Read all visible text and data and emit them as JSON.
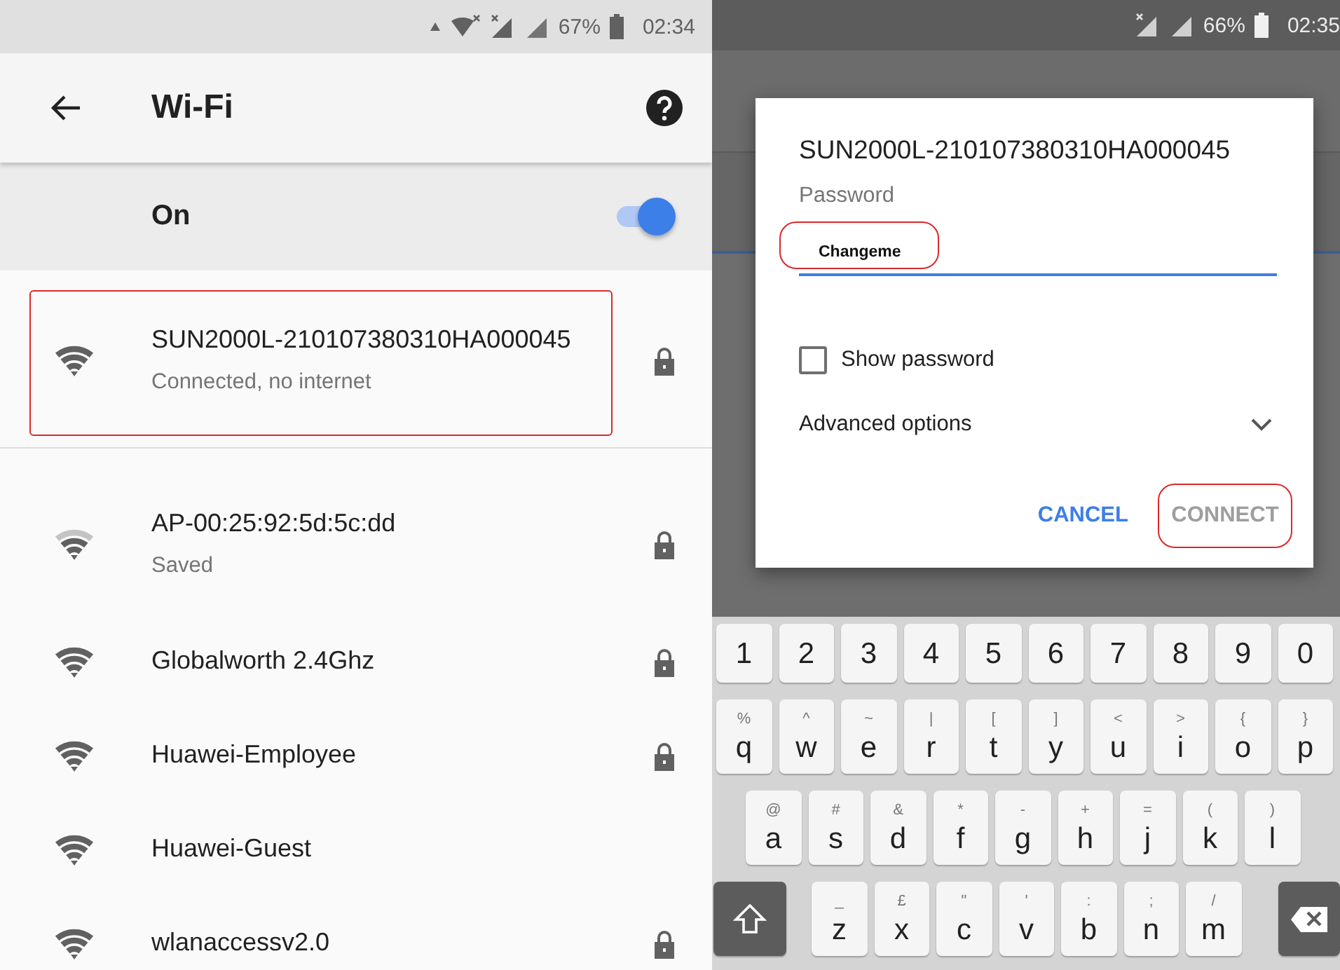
{
  "wifi_screen": {
    "status_bar": {
      "battery": "67%",
      "time": "02:34"
    },
    "title": "Wi-Fi",
    "switch": {
      "label": "On",
      "on": true
    },
    "networks": [
      {
        "name": "SUN2000L-210107380310HA000045",
        "status": "Connected, no internet",
        "weak_signal": false,
        "locked": true,
        "circled": true
      },
      {
        "name": "AP-00:25:92:5d:5c:dd",
        "status": "Saved",
        "weak_signal": true,
        "locked": true,
        "circled": false
      },
      {
        "name": "Globalworth 2.4Ghz",
        "weak_signal": false,
        "locked": true,
        "circled": false
      },
      {
        "name": "Huawei-Employee",
        "weak_signal": false,
        "locked": true,
        "circled": false
      },
      {
        "name": "Huawei-Guest",
        "weak_signal": false,
        "locked": false,
        "circled": false
      },
      {
        "name": "wlanaccessv2.0",
        "weak_signal": false,
        "locked": true,
        "circled": false
      }
    ]
  },
  "connect_screen": {
    "status_bar": {
      "battery": "66%",
      "time": "02:35"
    },
    "dialog": {
      "title": "SUN2000L-210107380310HA000045",
      "password_label": "Password",
      "password_value": "Changeme",
      "password_circled": true,
      "show_password": {
        "label": "Show password",
        "checked": false
      },
      "advanced": {
        "label": "Advanced options",
        "expanded": false
      },
      "buttons": [
        {
          "label": "CANCEL",
          "disabled": false,
          "circled": false
        },
        {
          "label": "CONNECT",
          "disabled": true,
          "circled": true
        }
      ]
    },
    "keyboard": {
      "rows": [
        [
          {
            "kind": "char",
            "main": "1"
          },
          {
            "kind": "char",
            "main": "2"
          },
          {
            "kind": "char",
            "main": "3"
          },
          {
            "kind": "char",
            "main": "4"
          },
          {
            "kind": "char",
            "main": "5"
          },
          {
            "kind": "char",
            "main": "6"
          },
          {
            "kind": "char",
            "main": "7"
          },
          {
            "kind": "char",
            "main": "8"
          },
          {
            "kind": "char",
            "main": "9"
          },
          {
            "kind": "char",
            "main": "0"
          }
        ],
        [
          {
            "kind": "char",
            "main": "q",
            "alt": "%"
          },
          {
            "kind": "char",
            "main": "w",
            "alt": "^"
          },
          {
            "kind": "char",
            "main": "e",
            "alt": "~"
          },
          {
            "kind": "char",
            "main": "r",
            "alt": "|"
          },
          {
            "kind": "char",
            "main": "t",
            "alt": "["
          },
          {
            "kind": "char",
            "main": "y",
            "alt": "]"
          },
          {
            "kind": "char",
            "main": "u",
            "alt": "<"
          },
          {
            "kind": "char",
            "main": "i",
            "alt": ">"
          },
          {
            "kind": "char",
            "main": "o",
            "alt": "{"
          },
          {
            "kind": "char",
            "main": "p",
            "alt": "}"
          }
        ],
        [
          {
            "kind": "char",
            "main": "a",
            "alt": "@"
          },
          {
            "kind": "char",
            "main": "s",
            "alt": "#"
          },
          {
            "kind": "char",
            "main": "d",
            "alt": "&"
          },
          {
            "kind": "char",
            "main": "f",
            "alt": "*"
          },
          {
            "kind": "char",
            "main": "g",
            "alt": "-"
          },
          {
            "kind": "char",
            "main": "h",
            "alt": "+"
          },
          {
            "kind": "char",
            "main": "j",
            "alt": "="
          },
          {
            "kind": "char",
            "main": "k",
            "alt": "("
          },
          {
            "kind": "char",
            "main": "l",
            "alt": ")"
          }
        ],
        [
          {
            "kind": "shift"
          },
          {
            "kind": "char",
            "main": "z",
            "alt": "_"
          },
          {
            "kind": "char",
            "main": "x",
            "alt": "£"
          },
          {
            "kind": "char",
            "main": "c",
            "alt": "\""
          },
          {
            "kind": "char",
            "main": "v",
            "alt": "'"
          },
          {
            "kind": "char",
            "main": "b",
            "alt": ":"
          },
          {
            "kind": "char",
            "main": "n",
            "alt": ";"
          },
          {
            "kind": "char",
            "main": "m",
            "alt": "/"
          },
          {
            "kind": "backspace"
          }
        ]
      ]
    }
  }
}
